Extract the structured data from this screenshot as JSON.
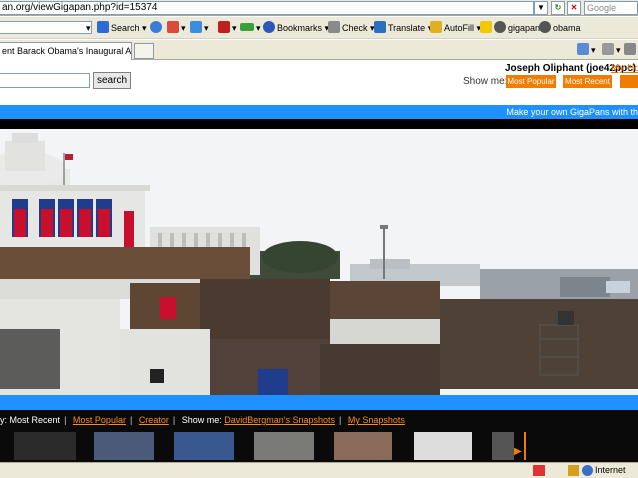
{
  "browser": {
    "url": "an.org/viewGigapan.php?id=15374",
    "search_placeholder": "Google",
    "tab_title": "ent Barack Obama's Inaugural Addres...",
    "status_zone": "Internet"
  },
  "toolbar": {
    "search_label": "Search",
    "bookmarks_label": "Bookmarks",
    "check_label": "Check",
    "translate_label": "Translate",
    "autofill_label": "AutoFill",
    "gigapan_label": "gigapan",
    "obama_label": "obama"
  },
  "page": {
    "search_button": "search",
    "user_name": "Joseph  Oliphant (joe42ppc)",
    "my_home": "My Hom",
    "show_me_label": "Show me:",
    "most_popular_btn": "Most Popular",
    "most_recent_btn": "Most Recent",
    "make_own": "Make your own GigaPans with th"
  },
  "snapshots": {
    "prefix": "y:",
    "most_recent": "Most Recent",
    "most_popular": "Most Popular",
    "creator": "Creator",
    "show_me": "Show me:",
    "user_snapshots": "DavidBergman's Snapshots",
    "my_snapshots": "My Snapshots"
  },
  "colors": {
    "accent_orange": "#f07c00",
    "banner_blue": "#1e90ff"
  }
}
